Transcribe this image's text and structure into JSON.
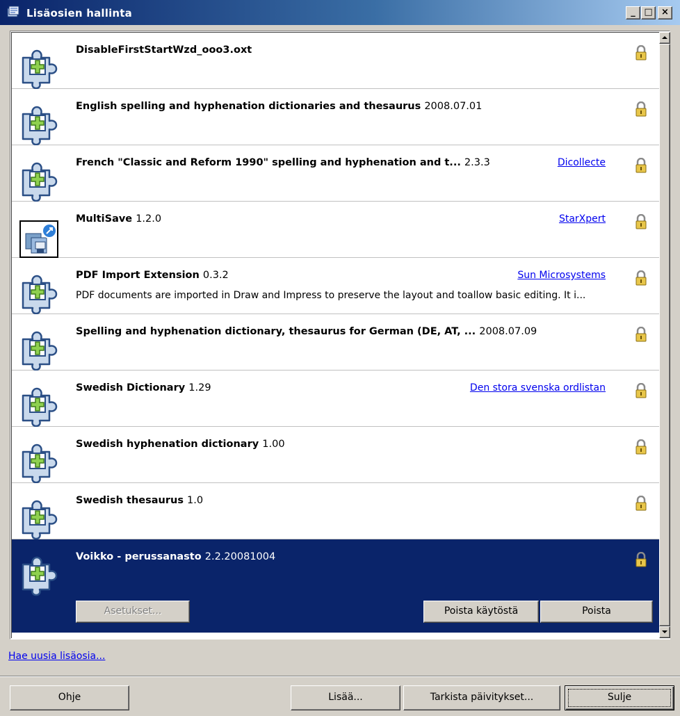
{
  "window": {
    "title": "Lisäosien hallinta",
    "minimize_glyph": "_",
    "maximize_glyph": "□",
    "close_glyph": "×"
  },
  "extensions": [
    {
      "name": "DisableFirstStartWzd_ooo3.oxt",
      "version": "",
      "publisher": "",
      "description": "",
      "icon": "puzzle-icon",
      "locked": true
    },
    {
      "name": "English spelling and hyphenation dictionaries and thesaurus",
      "version": "2008.07.01",
      "publisher": "",
      "description": "",
      "icon": "puzzle-icon",
      "locked": true
    },
    {
      "name": "French \"Classic and Reform 1990\" spelling and hyphenation and t...",
      "version": "2.3.3",
      "publisher": "Dicollecte",
      "description": "",
      "icon": "puzzle-icon",
      "locked": true
    },
    {
      "name": "MultiSave",
      "version": "1.2.0",
      "publisher": "StarXpert",
      "description": "",
      "icon": "multisave-icon",
      "locked": true
    },
    {
      "name": "PDF Import Extension",
      "version": "0.3.2",
      "publisher": "Sun Microsystems",
      "description": "PDF documents are imported in Draw and Impress to preserve the layout and toallow basic editing. It i...",
      "icon": "puzzle-icon",
      "locked": true
    },
    {
      "name": "Spelling and hyphenation dictionary, thesaurus for German (DE, AT, ...",
      "version": "2008.07.09",
      "publisher": "",
      "description": "",
      "icon": "puzzle-icon",
      "locked": true
    },
    {
      "name": "Swedish Dictionary",
      "version": "1.29",
      "publisher": "Den stora svenska ordlistan",
      "description": "",
      "icon": "puzzle-icon",
      "locked": true
    },
    {
      "name": "Swedish hyphenation dictionary",
      "version": "1.00",
      "publisher": "",
      "description": "",
      "icon": "puzzle-icon",
      "locked": true
    },
    {
      "name": "Swedish thesaurus",
      "version": "1.0",
      "publisher": "",
      "description": "",
      "icon": "puzzle-icon",
      "locked": true
    },
    {
      "name": "Voikko - perussanasto",
      "version": "2.2.20081004",
      "publisher": "",
      "description": "",
      "icon": "puzzle-icon",
      "locked": true,
      "selected": true
    }
  ],
  "selected_actions": {
    "options_label": "Asetukset...",
    "disable_label": "Poista käytöstä",
    "remove_label": "Poista"
  },
  "get_more_link": "Hae uusia lisäosia...",
  "buttons": {
    "help": "Ohje",
    "add": "Lisää...",
    "check_updates": "Tarkista päivitykset...",
    "close": "Sulje"
  },
  "colors": {
    "selection": "#0a246a",
    "link": "#0000ee",
    "dialog_face": "#d4d0c8"
  }
}
